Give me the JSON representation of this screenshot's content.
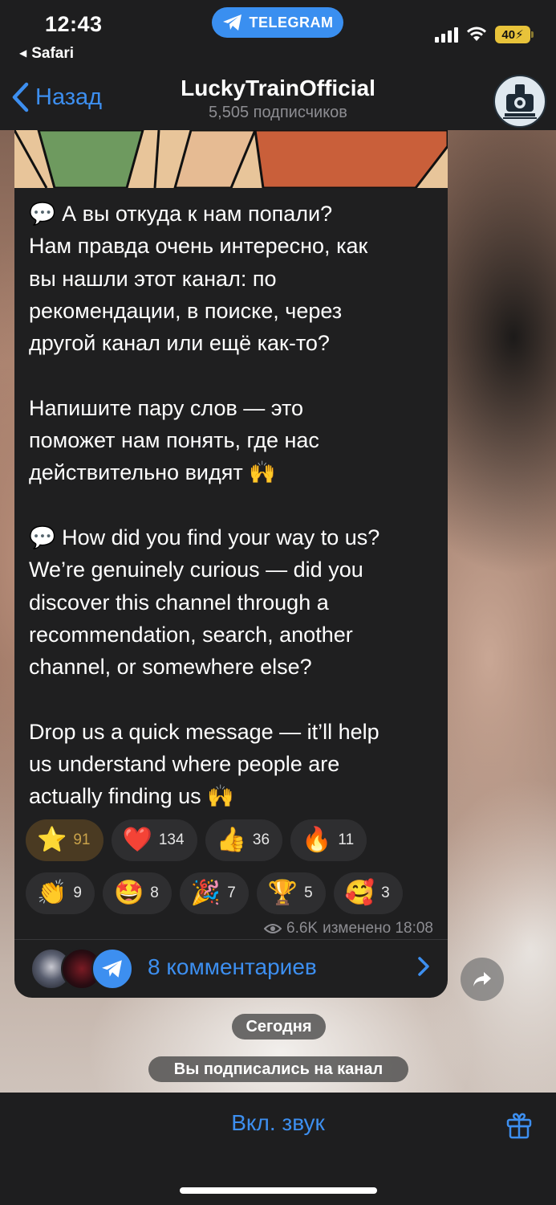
{
  "status_bar": {
    "time": "12:43",
    "back_app": "Safari",
    "app_pill": "TELEGRAM",
    "battery": "40"
  },
  "header": {
    "back_label": "Назад",
    "title": "LuckyTrainOfficial",
    "subtitle": "5,505 подписчиков"
  },
  "message": {
    "text": "💬 А вы откуда к нам попали?\nНам правда очень интересно, как\nвы нашли этот канал: по\nрекомендации, в поиске, через\nдругой канал или ещё как-то?\n\nНапишите пару слов — это\nпоможет нам понять, где нас\nдействительно видят 🙌\n\n💬 How did you find your way to us?\nWe’re genuinely curious — did you\ndiscover this channel through a\nrecommendation, search, another\nchannel, or somewhere else?\n\nDrop us a quick message — it’ll help\nus understand where people are\nactually finding us 🙌",
    "reactions_row1": [
      {
        "emoji": "⭐",
        "count": "91"
      },
      {
        "emoji": "❤️",
        "count": "134"
      },
      {
        "emoji": "👍",
        "count": "36"
      },
      {
        "emoji": "🔥",
        "count": "11"
      }
    ],
    "reactions_row2": [
      {
        "emoji": "👏",
        "count": "9"
      },
      {
        "emoji": "🤩",
        "count": "8"
      },
      {
        "emoji": "🎉",
        "count": "7"
      },
      {
        "emoji": "🏆",
        "count": "5"
      },
      {
        "emoji": "🥰",
        "count": "3"
      }
    ],
    "views": "6.6K",
    "edited_time": "изменено 18:08",
    "comments_label": "8 комментариев"
  },
  "service": {
    "date_label": "Сегодня",
    "joined_label": "Вы подписались на канал"
  },
  "bottom": {
    "unmute_label": "Вкл. звук"
  },
  "colors": {
    "accent": "#3d8ff0",
    "bar_bg": "#1e1e1f",
    "bubble_bg": "#1f1f20",
    "battery": "#e8c33a"
  }
}
